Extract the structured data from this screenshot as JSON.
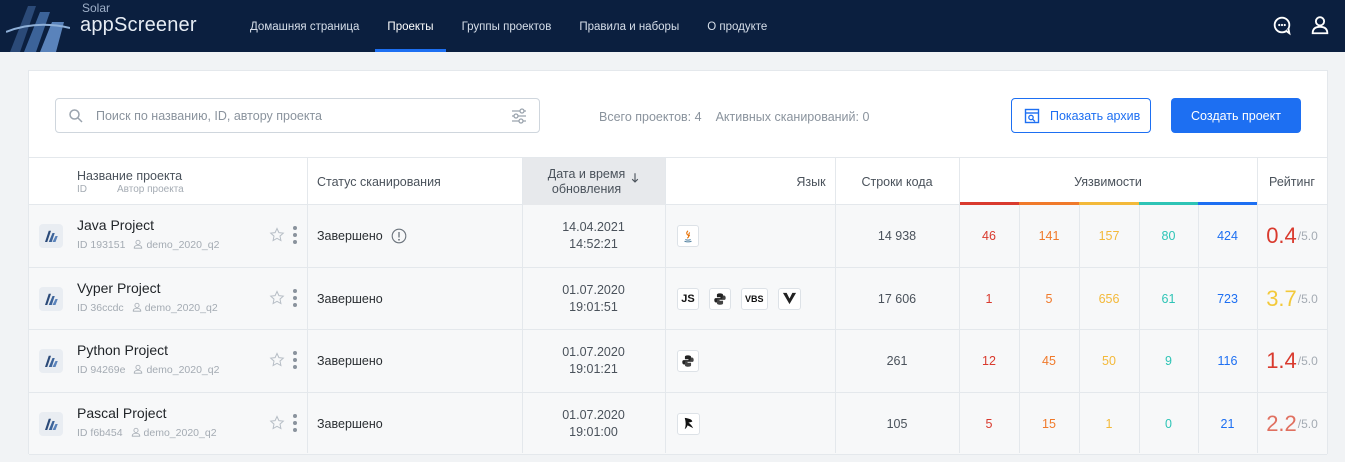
{
  "colors": {
    "topbar": "#0b1f3f",
    "accent": "#1d6ff2",
    "critical": "#d93a2e",
    "high": "#f07a2b",
    "medium": "#f3b93a",
    "low": "#2ec4b6",
    "info": "#1d6ff2"
  },
  "app": {
    "logo_small": "Solar",
    "logo_big": "appScreener"
  },
  "nav": [
    {
      "label": "Домашняя страница",
      "active": false
    },
    {
      "label": "Проекты",
      "active": true
    },
    {
      "label": "Группы проектов",
      "active": false
    },
    {
      "label": "Правила и наборы",
      "active": false
    },
    {
      "label": "О продукте",
      "active": false
    }
  ],
  "search": {
    "placeholder": "Поиск по названию, ID, автору проекта"
  },
  "stats": {
    "total": "Всего проектов: 4",
    "active": "Активных сканирований: 0"
  },
  "buttons": {
    "archive": "Показать архив",
    "create": "Создать проект"
  },
  "table": {
    "headers": {
      "name": "Название проекта",
      "id": "ID",
      "author": "Автор проекта",
      "status": "Статус сканирования",
      "date_line1": "Дата и время",
      "date_line2": "обновления",
      "language": "Язык",
      "loc": "Строки кода",
      "vulns": "Уязвимости",
      "rating": "Рейтинг"
    },
    "rows": [
      {
        "name": "Java Project",
        "id": "ID 193151",
        "author": "demo_2020_q2",
        "status": "Завершено",
        "status_info_icon": true,
        "date": "14.04.2021",
        "time": "14:52:21",
        "languages": [
          "java-icon"
        ],
        "loc": "14 938",
        "v1": "46",
        "v2": "141",
        "v3": "157",
        "v4": "80",
        "v5": "424",
        "rating": "0.4",
        "rating_max": "/5.0",
        "rating_color": "#d93a2e"
      },
      {
        "name": "Vyper Project",
        "id": "ID 36ccdc",
        "author": "demo_2020_q2",
        "status": "Завершено",
        "status_info_icon": false,
        "date": "01.07.2020",
        "time": "19:01:51",
        "languages": [
          "JS",
          "python-icon",
          "VBS",
          "vyper-icon"
        ],
        "loc": "17 606",
        "v1": "1",
        "v2": "5",
        "v3": "656",
        "v4": "61",
        "v5": "723",
        "rating": "3.7",
        "rating_max": "/5.0",
        "rating_color": "#f3c93a"
      },
      {
        "name": "Python Project",
        "id": "ID 94269e",
        "author": "demo_2020_q2",
        "status": "Завершено",
        "status_info_icon": false,
        "date": "01.07.2020",
        "time": "19:01:21",
        "languages": [
          "python-icon"
        ],
        "loc": "261",
        "v1": "12",
        "v2": "45",
        "v3": "50",
        "v4": "9",
        "v5": "116",
        "rating": "1.4",
        "rating_max": "/5.0",
        "rating_color": "#d93a2e"
      },
      {
        "name": "Pascal Project",
        "id": "ID f6b454",
        "author": "demo_2020_q2",
        "status": "Завершено",
        "status_info_icon": false,
        "date": "01.07.2020",
        "time": "19:01:00",
        "languages": [
          "pascal-icon"
        ],
        "loc": "105",
        "v1": "5",
        "v2": "15",
        "v3": "1",
        "v4": "0",
        "v5": "21",
        "rating": "2.2",
        "rating_max": "/5.0",
        "rating_color": "#e07060"
      }
    ]
  }
}
